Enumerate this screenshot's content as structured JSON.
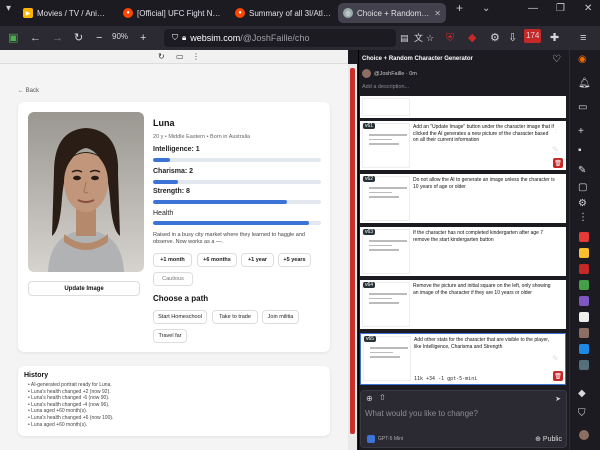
{
  "browser": {
    "tabs": [
      {
        "title": "Movies / TV / Anime • fr",
        "active": false,
        "icon": "movie-icon"
      },
      {
        "title": "[Official] UFC Fight Night",
        "active": false,
        "icon": "reddit-icon"
      },
      {
        "title": "Summary of all 3I/Atlas a",
        "active": false,
        "icon": "reddit-icon"
      },
      {
        "title": "Choice + Random Chara",
        "active": true,
        "icon": "websim-icon"
      }
    ],
    "new_tab": "+",
    "zoom": "90%",
    "url_domain": "websim.com",
    "url_path": "/@JoshFaille/cho",
    "notification_count": "174"
  },
  "frame_toolbar": {
    "reload": "↻",
    "desktop": "▭",
    "code": "⋮"
  },
  "app": {
    "back_label": "← Back",
    "character": {
      "name": "Luna",
      "meta": "20 y • Middle Eastern • Born in Australia",
      "stats": [
        {
          "label": "Intelligence: 1",
          "level": 0.1
        },
        {
          "label": "Charisma: 2",
          "level": 0.15
        },
        {
          "label": "Strength: 8",
          "level": 0.8
        },
        {
          "label": "Health",
          "level": 0.93
        }
      ],
      "bio": "Raised in a busy city market where they learned to haggle and observe. Now works as a —.",
      "time_buttons": [
        "+1 month",
        "+6 months",
        "+1 year",
        "+5 years"
      ],
      "cautious_label": "Cautious",
      "update_image_label": "Update Image",
      "path_title": "Choose a path",
      "paths": [
        "Start Homeschool",
        "Take to trade",
        "Join militia",
        "Travel far"
      ]
    },
    "history": {
      "title": "History",
      "items": [
        "AI-generated portrait ready for Luna.",
        "Luna's health changed +2 (now 92).",
        "Luna's health changed -6 (now 90).",
        "Luna's health changed -4 (now 96).",
        "Luna aged +60 month(s).",
        "Luna's health changed +6 (now 100).",
        "Luna aged +60 month(s)."
      ]
    }
  },
  "panel": {
    "title": "Choice + Random Character Generator",
    "author": "@JoshFaille · 0m",
    "description_placeholder": "Add a description...",
    "versions": [
      {
        "tag": "",
        "text": ""
      },
      {
        "tag": "v61",
        "text": "Add an \"Update Image\" button under the character image that if clicked the AI generates a new picture of the character based on all their current information"
      },
      {
        "tag": "v62",
        "text": "Do not allow the AI to generate an image unless the character is 10 years of age or older"
      },
      {
        "tag": "v63",
        "text": "If the character has not completed kindergarten after age 7 remove the start kindergarten button"
      },
      {
        "tag": "v64",
        "text": "Remove the picture and initial square on the left, only showing an image of the character if they are 10 years or older"
      },
      {
        "tag": "v65",
        "text": "Add other stats for the character that are visible to the player, like Intelligence, Charisma and Strength"
      }
    ],
    "selected_meta": "11k +34 -1 gpt-5-mini",
    "chat_placeholder": "What would you like to change?",
    "model_label": "GPT-5 Mini",
    "visibility_label": "Public"
  }
}
